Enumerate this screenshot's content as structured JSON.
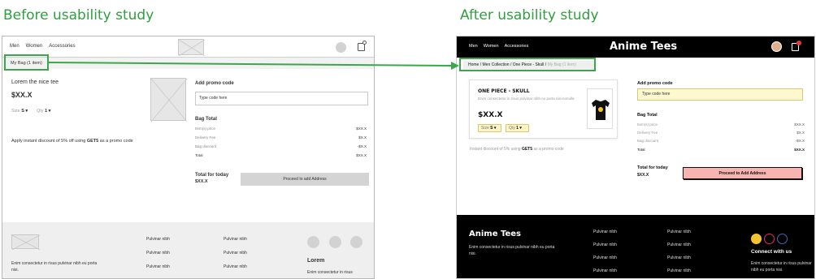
{
  "labels": {
    "before": "Before usability study",
    "after": "After usability study"
  },
  "colors": {
    "accent_green": "#2e9e3e",
    "highlight_yellow": "#fcf4c4",
    "cta_pink": "#f8b4b0",
    "dark": "#000000"
  },
  "before": {
    "nav": [
      "Men",
      "Women",
      "Accessories"
    ],
    "breadcrumb": "My Bag (1 item)",
    "product_name": "Lorem the nice tee",
    "price": "$XX.X",
    "size_label": "Size",
    "size_value": "S",
    "qty_label": "Qty",
    "qty_value": "1",
    "discount_text_pre": "Apply instant discount of 5% off using ",
    "discount_code": "GET5",
    "discount_text_post": " as a promo code",
    "promo_heading": "Add promo code",
    "promo_placeholder": "Type code here",
    "bag_total_heading": "Bag Total",
    "rows": [
      {
        "label": "Item(s) price",
        "value": "$XX.X"
      },
      {
        "label": "Delivery Fee",
        "value": "$X.X"
      },
      {
        "label": "Bag discount",
        "value": "-$X.X"
      },
      {
        "label": "Total",
        "value": "$XX.X"
      }
    ],
    "today_heading": "Total for today",
    "today_value": "$XX.X",
    "proceed_label": "Proceed to add Address",
    "footer_text": "Enim consectetur in risus pulvinar nibh eu porta nisi.",
    "footer_col1": [
      "Pulvinar nibh",
      "Pulvinar nibh",
      "Pulvinar nibh"
    ],
    "footer_col2": [
      "Pulvinar nibh",
      "Pulvinar nibh",
      "Pulvinar nibh"
    ],
    "lorem_heading": "Lorem",
    "lorem_text": "Enim consectetur in risus"
  },
  "after": {
    "nav": [
      "Men",
      "Women",
      "Accessories"
    ],
    "brand": "Anime Tees",
    "breadcrumb": [
      "Home",
      "Men Collection",
      "One Piece - Skull"
    ],
    "breadcrumb_current": "My Bag (1 item)",
    "product_title": "ONE PIECE - SKULL",
    "product_desc": "Enim consectetur in risus pulvinar nibh eu porta nisi nonulla",
    "price": "$XX.X",
    "size_label": "Size",
    "size_value": "S",
    "qty_label": "Qty",
    "qty_value": "1",
    "discount_text_pre": "Instant discount of 5% using ",
    "discount_code": "GET5",
    "discount_text_post": " as a promo code",
    "promo_heading": "Add promo code",
    "promo_placeholder": "Type code here",
    "bag_total_heading": "Bag Total",
    "rows": [
      {
        "label": "Item(s) price",
        "value": "$XX.X"
      },
      {
        "label": "Delivery Fee",
        "value": "$X.X"
      },
      {
        "label": "Bag discount",
        "value": "-$X.X"
      },
      {
        "label": "Total",
        "value": "$XX.X"
      }
    ],
    "today_heading": "Total for today",
    "today_value": "$XX.X",
    "proceed_label": "Proceed to Add Address",
    "footer_brand": "Anime Tees",
    "footer_text": "Enim consectetur in risus pulvinar nibh eu porta nisi.",
    "footer_col1": [
      "Pulvinar nibh",
      "Pulvinar nibh",
      "Pulvinar nibh",
      "Pulvinar nibh"
    ],
    "footer_col2": [
      "Pulvinar nibh",
      "Pulvinar nibh",
      "Pulvinar nibh",
      "Pulvinar nibh"
    ],
    "connect_heading": "Connect with us",
    "connect_text": "Enim consectetur in risus pulvinar nibh eu porta nisi."
  }
}
